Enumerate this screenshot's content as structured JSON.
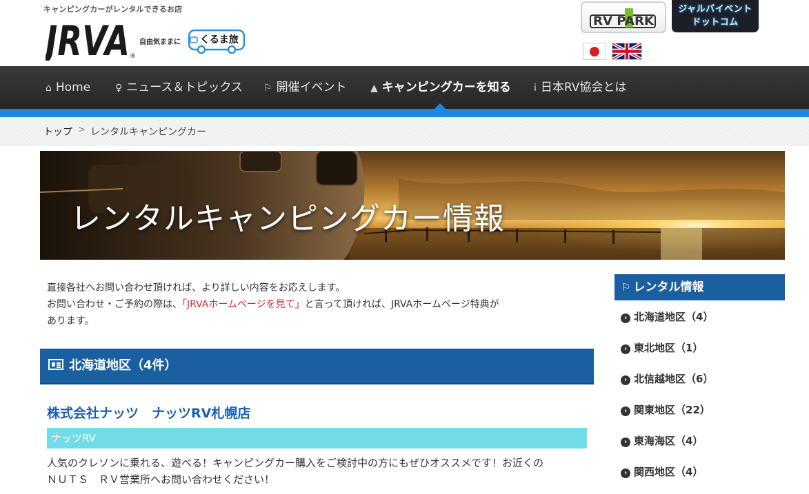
{
  "header": {
    "tagline": "キャンピングカーがレンタルできるお店",
    "logo_text": "JRVA",
    "logo_sub": "自由気ままに",
    "kuruma_text": "くるま旅",
    "rvpark_text": "RV PARK",
    "jyaru_line1": "ジャルバイベント",
    "jyaru_line2": "ドットコム"
  },
  "nav": {
    "items": [
      {
        "label": "Home",
        "icon": "home-icon"
      },
      {
        "label": "ニュース＆トピックス",
        "icon": "lightbulb-icon"
      },
      {
        "label": "開催イベント",
        "icon": "flag-icon"
      },
      {
        "label": "キャンピングカーを知る",
        "icon": "graduation-cap-icon"
      },
      {
        "label": "日本RV協会とは",
        "icon": "info-icon"
      }
    ]
  },
  "breadcrumb": {
    "home": "トップ",
    "separator": ">",
    "current": "レンタルキャンピングカー"
  },
  "hero": {
    "title": "レンタルキャンピングカー情報"
  },
  "intro": {
    "line1": "直接各社へお問い合わせ頂ければ、より詳しい内容をお応えします。",
    "line2_pre": "お問い合わせ・ご予約の際は、",
    "line2_red": "「JRVAホームページを見て」",
    "line2_post": "と言って頂ければ、JRVAホームページ特典が",
    "line3": "あります。"
  },
  "region": {
    "title": "北海道地区（4件）"
  },
  "shop": {
    "title": "株式会社ナッツ　ナッツRV札幌店",
    "brand": "ナッツRV",
    "desc_line1": "人気のクレソンに乗れる、遊べる！キャンピングカー購入をご検討中の方にもぜひオススメです！お近くの",
    "desc_line2": "ＮＵＴＳ　ＲＶ営業所へお問い合わせください！"
  },
  "sidebar": {
    "heading": "レンタル情報",
    "items": [
      {
        "label": "北海道地区（4）"
      },
      {
        "label": "東北地区（1）"
      },
      {
        "label": "北信越地区（6）"
      },
      {
        "label": "関東地区（22）"
      },
      {
        "label": "東海海区（4）"
      },
      {
        "label": "関西地区（4）"
      }
    ]
  },
  "colors": {
    "nav_accent": "#1e86df",
    "region_blue": "#1a5fa0",
    "brand_cyan": "#72dbe8",
    "link_blue": "#1a62b0",
    "notice_red": "#d32f2f"
  }
}
